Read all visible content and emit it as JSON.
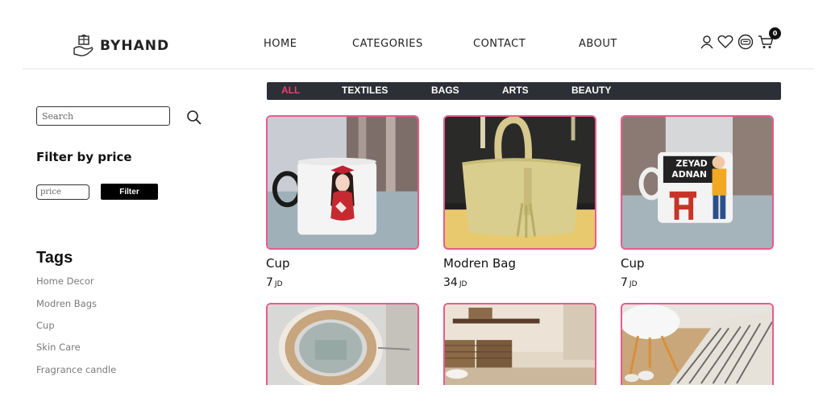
{
  "brand": {
    "name": "BYHAND",
    "logo_icon": "hand-gift-logo"
  },
  "nav": {
    "items": [
      "HOME",
      "CATEGORIES",
      "CONTACT",
      "ABOUT"
    ]
  },
  "header_icons": {
    "user": "user-icon",
    "wishlist": "heart-icon",
    "account": "badge-icon",
    "cart": "cart-icon",
    "cart_count": "0"
  },
  "categories": {
    "items": [
      "ALL",
      "TEXTILES",
      "BAGS",
      "ARTS",
      "BEAUTY"
    ],
    "active": "ALL",
    "active_color": "#e8406e"
  },
  "sidebar": {
    "search_placeholder": "Search",
    "filter_title": "Filter by price",
    "price_placeholder": "price",
    "filter_button": "Filter",
    "tags_title": "Tags",
    "tags": [
      "Home Decor",
      "Modren Bags",
      "Cup",
      "Skin Care",
      "Fragrance candle"
    ]
  },
  "products": [
    {
      "name": "Cup",
      "price": "7",
      "currency": "JD"
    },
    {
      "name": "Modren Bag",
      "price": "34",
      "currency": "JD"
    },
    {
      "name": "Cup",
      "price": "7",
      "currency": "JD"
    },
    {
      "name": "",
      "price": "",
      "currency": ""
    },
    {
      "name": "",
      "price": "",
      "currency": ""
    },
    {
      "name": "",
      "price": "",
      "currency": ""
    }
  ],
  "photo_text": {
    "mug_sign_line1": "ZEYAD",
    "mug_sign_line2": "ADNAN"
  },
  "colors": {
    "card_border": "#e85b8c",
    "category_bar": "#2c2f36"
  }
}
